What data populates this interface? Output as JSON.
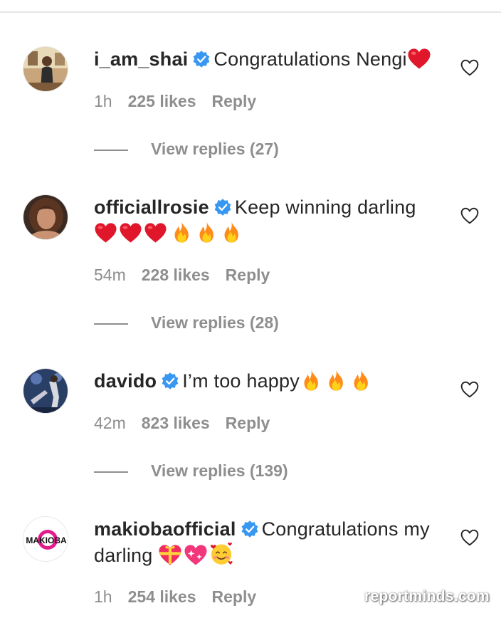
{
  "comments": [
    {
      "username": "i_am_shai",
      "line1": "Congratulations Nengi",
      "emojis1": [
        "heart"
      ],
      "time": "1h",
      "likes": "225 likes",
      "reply": "Reply",
      "view_replies": "View replies (27)"
    },
    {
      "username": "officiallrosie",
      "line1": "Keep winning darling",
      "emojis2": [
        "heart",
        "heart",
        "heart",
        "fire",
        "fire",
        "fire"
      ],
      "time": "54m",
      "likes": "228 likes",
      "reply": "Reply",
      "view_replies": "View replies (28)"
    },
    {
      "username": "davido",
      "line1": "I’m too happy",
      "emojis1": [
        "fire",
        "fire",
        "fire"
      ],
      "time": "42m",
      "likes": "823 likes",
      "reply": "Reply",
      "view_replies": "View replies (139)"
    },
    {
      "username": "makiobaofficial",
      "line1": "Congratulations my",
      "line2": "darling",
      "emojis2": [
        "gift-heart",
        "sparkling-heart",
        "smiling-face-with-hearts"
      ],
      "time": "1h",
      "likes": "254 likes",
      "reply": "Reply",
      "avatar_text": "MAKIOBA"
    }
  ],
  "watermark": "reportminds.com",
  "colors": {
    "text": "#262626",
    "secondary": "#8e8e8e",
    "verified": "#3897f0",
    "heart_emoji": "#e0162b",
    "fire": "#ff7a00"
  },
  "icons": [
    "verified-badge-icon",
    "heart-outline-icon",
    "red-heart-emoji-icon",
    "fire-emoji-icon"
  ]
}
